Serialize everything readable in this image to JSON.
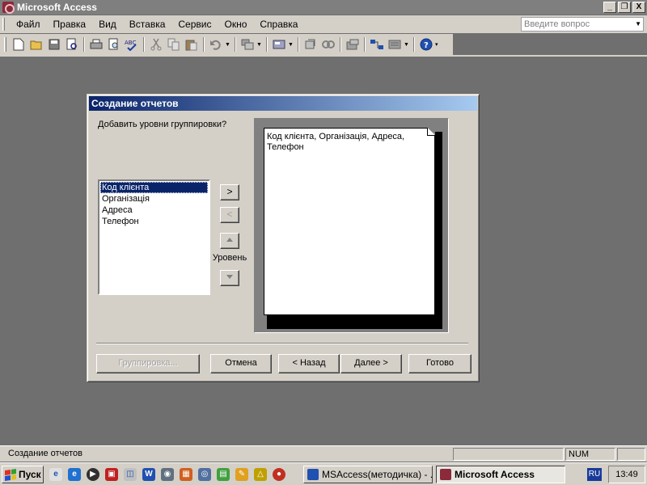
{
  "window": {
    "title": "Microsoft Access",
    "minimize": "_",
    "maximize": "❐",
    "close": "X"
  },
  "menu": {
    "items": [
      "Файл",
      "Правка",
      "Вид",
      "Вставка",
      "Сервис",
      "Окно",
      "Справка"
    ],
    "ask_placeholder": "Введите вопрос"
  },
  "toolbar": {
    "icons": [
      "new-icon",
      "open-icon",
      "save-icon",
      "search-file-icon",
      "print-icon",
      "print-preview-icon",
      "spell-check-icon",
      "cut-icon",
      "copy-icon",
      "paste-icon",
      "undo-icon",
      "office-links-icon",
      "analyze-icon",
      "code-icon",
      "script-icon",
      "properties-icon",
      "relationships-icon",
      "new-object-icon",
      "help-icon"
    ]
  },
  "dialog": {
    "title": "Создание отчетов",
    "prompt": "Добавить уровни группировки?",
    "fields": [
      "Код клієнта",
      "Організація",
      "Адреса",
      "Телефон"
    ],
    "selected_field": "Код клієнта",
    "add_button": ">",
    "remove_button": "<",
    "level_label": "Уровень",
    "preview_text": "Код клієнта, Організація, Адреса, Телефон",
    "buttons": {
      "grouping": "Группировка...",
      "cancel": "Отмена",
      "back": "< Назад",
      "next": "Далее >",
      "finish": "Готово"
    }
  },
  "statusbar": {
    "text": "Создание отчетов",
    "num": "NUM"
  },
  "taskbar": {
    "start": "Пуск",
    "tasks": [
      {
        "label": "MSAccess(методичка) - ...",
        "active": false
      },
      {
        "label": "Microsoft Access",
        "active": true
      }
    ],
    "language": "RU",
    "clock": "13:49"
  }
}
